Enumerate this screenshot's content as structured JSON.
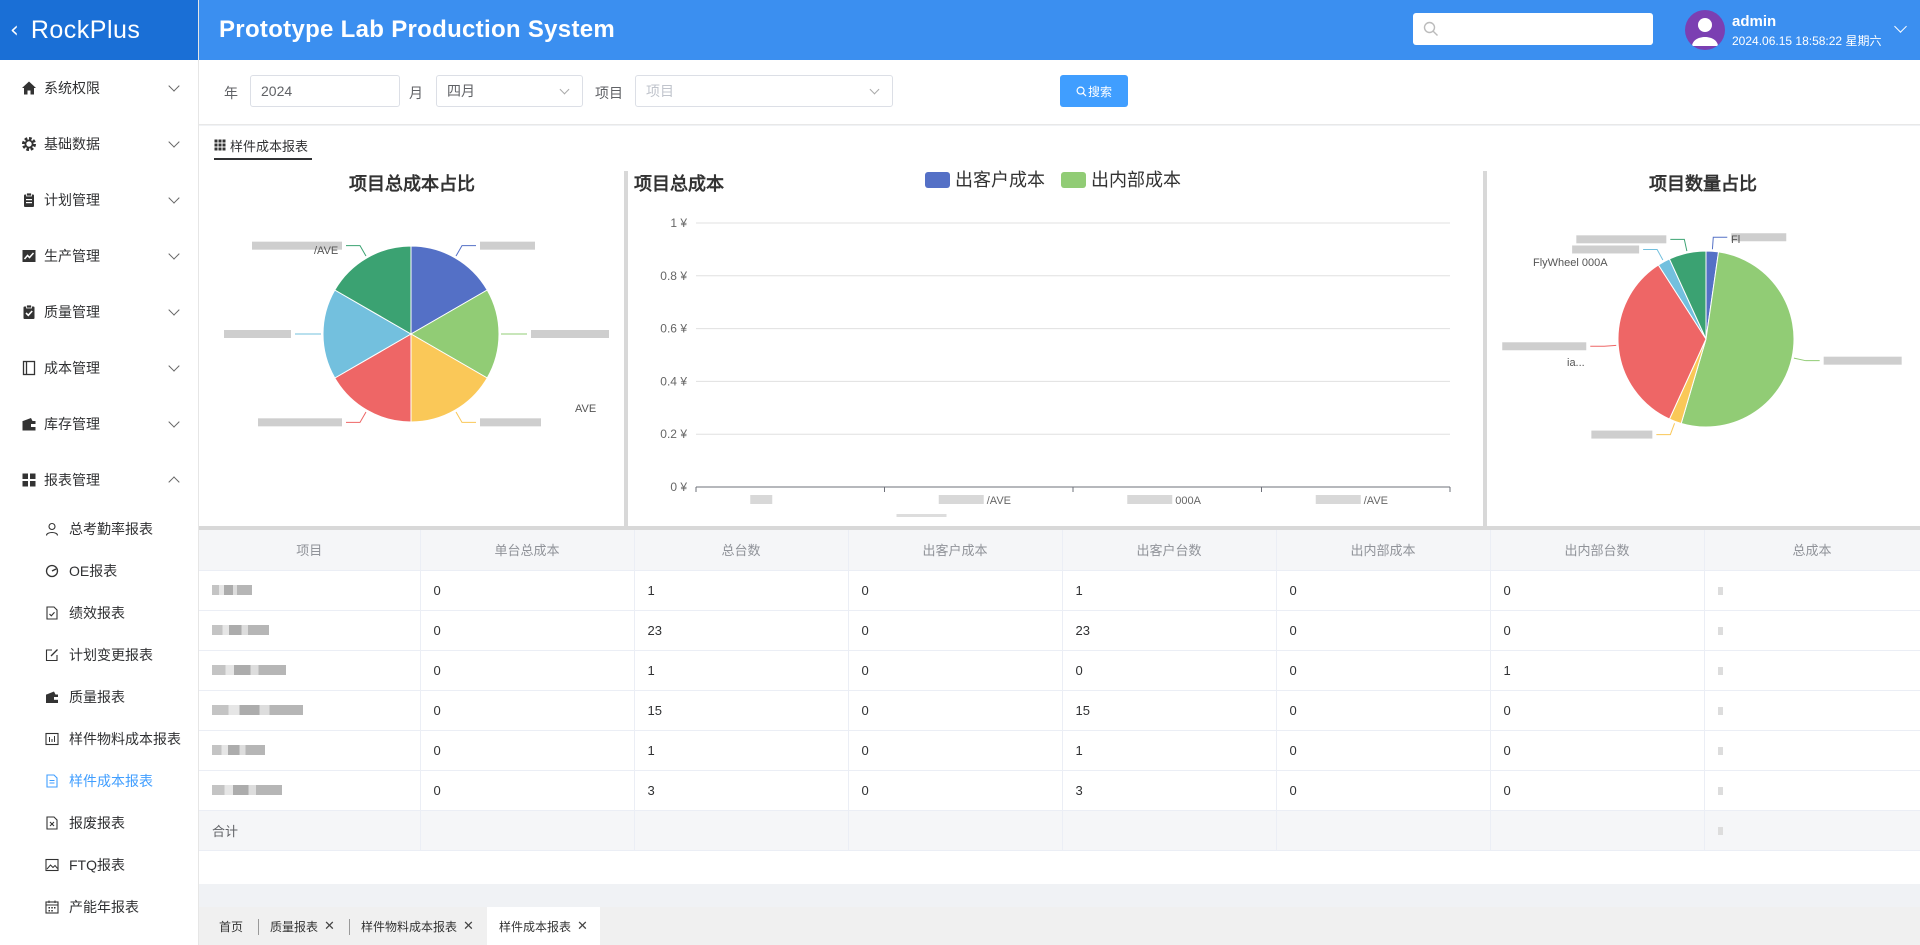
{
  "app": {
    "brand": "RockPlus",
    "title": "Prototype Lab Production System"
  },
  "header": {
    "search_placeholder": "",
    "user_name": "admin",
    "datetime": "2024.06.15 18:58:22 星期六"
  },
  "sidebar": {
    "menus": [
      {
        "label": "系统权限",
        "icon": "home-icon"
      },
      {
        "label": "基础数据",
        "icon": "gear-icon"
      },
      {
        "label": "计划管理",
        "icon": "clipboard-icon"
      },
      {
        "label": "生产管理",
        "icon": "trend-chart-icon"
      },
      {
        "label": "质量管理",
        "icon": "check-clipboard-icon"
      },
      {
        "label": "成本管理",
        "icon": "notebook-icon"
      },
      {
        "label": "库存管理",
        "icon": "wallet-icon"
      },
      {
        "label": "报表管理",
        "icon": "grid-icon"
      }
    ],
    "report_items": [
      {
        "label": "总考勤率报表",
        "icon": "user-icon"
      },
      {
        "label": "OE报表",
        "icon": "gauge-icon"
      },
      {
        "label": "绩效报表",
        "icon": "document-check-icon"
      },
      {
        "label": "计划变更报表",
        "icon": "edit-icon"
      },
      {
        "label": "质量报表",
        "icon": "wallet-icon"
      },
      {
        "label": "样件物料成本报表",
        "icon": "histogram-icon"
      },
      {
        "label": "样件成本报表",
        "icon": "document-icon"
      },
      {
        "label": "报废报表",
        "icon": "document-remove-icon"
      },
      {
        "label": "FTQ报表",
        "icon": "picture-icon"
      },
      {
        "label": "产能年报表",
        "icon": "calendar-icon"
      }
    ]
  },
  "filters": {
    "year_label": "年",
    "year_value": "2024",
    "month_label": "月",
    "month_value": "四月",
    "project_label": "项目",
    "project_placeholder": "项目",
    "search_button": "搜索"
  },
  "panel": {
    "tab_label": "样件成本报表"
  },
  "chart_data": [
    {
      "type": "pie",
      "title": "项目总成本占比",
      "labels": [
        "",
        "",
        "",
        "",
        "",
        ""
      ],
      "values": [
        1,
        1,
        1,
        1,
        1,
        1
      ],
      "colors": [
        "#5470c6",
        "#91cc75",
        "#fac858",
        "#ee6666",
        "#73c0de",
        "#3ba272",
        "#fc8452"
      ],
      "visible_label_fragments": [
        "/AVE",
        "AVE"
      ]
    },
    {
      "type": "bar",
      "title": "项目总成本",
      "categories": [
        "",
        "/AVE",
        "000A",
        "/AVE"
      ],
      "series": [
        {
          "name": "出客户成本",
          "values": [
            0,
            0,
            0,
            0
          ],
          "color": "#5470c6"
        },
        {
          "name": "出内部成本",
          "values": [
            0,
            0,
            0,
            0
          ],
          "color": "#91cc75"
        }
      ],
      "ylim": [
        0,
        1
      ],
      "yticks": [
        "0 ¥",
        "0.2 ¥",
        "0.4 ¥",
        "0.6 ¥",
        "0.8 ¥",
        "1 ¥"
      ],
      "legend": "top-center",
      "grid": true
    },
    {
      "type": "pie",
      "title": "项目数量占比",
      "labels": [
        "",
        "",
        "",
        "",
        "",
        ""
      ],
      "values": [
        1,
        23,
        1,
        15,
        1,
        3
      ],
      "colors": [
        "#5470c6",
        "#91cc75",
        "#fac858",
        "#ee6666",
        "#73c0de",
        "#3ba272",
        "#fc8452"
      ],
      "visible_label_fragments": [
        "Fl",
        "FlyWheel 000A",
        "ia..."
      ]
    }
  ],
  "table": {
    "headers": [
      "项目",
      "单台总成本",
      "总台数",
      "出客户成本",
      "出客户台数",
      "出内部成本",
      "出内部台数",
      "总成本"
    ],
    "rows": [
      [
        "",
        "0",
        "1",
        "0",
        "1",
        "0",
        "0",
        ""
      ],
      [
        "",
        "0",
        "23",
        "0",
        "23",
        "0",
        "0",
        ""
      ],
      [
        "",
        "0",
        "1",
        "0",
        "0",
        "0",
        "1",
        ""
      ],
      [
        "",
        "0",
        "15",
        "0",
        "15",
        "0",
        "0",
        ""
      ],
      [
        "",
        "0",
        "1",
        "0",
        "1",
        "0",
        "0",
        ""
      ],
      [
        "",
        "0",
        "3",
        "0",
        "3",
        "0",
        "0",
        ""
      ]
    ],
    "sum_label": "合计"
  },
  "bottom_tabs": [
    {
      "label": "首页",
      "closable": false
    },
    {
      "label": "质量报表",
      "closable": true
    },
    {
      "label": "样件物料成本报表",
      "closable": true
    },
    {
      "label": "样件成本报表",
      "closable": true
    }
  ],
  "colors": {
    "header_bg": "#3b8ff0",
    "logo_bg": "#1a6fd6",
    "accent": "#409eff",
    "avatar": "#7b3fb2"
  }
}
